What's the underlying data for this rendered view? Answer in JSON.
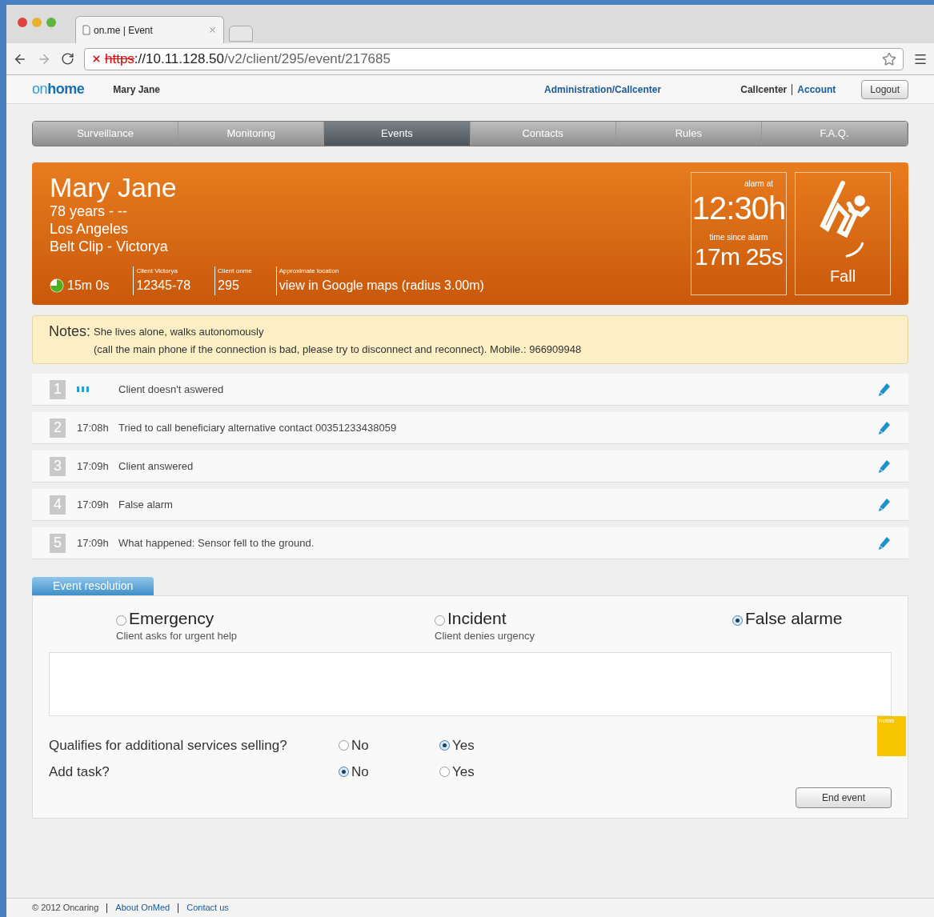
{
  "browser": {
    "tab_title": "on.me | Event",
    "url": {
      "scheme": "https",
      "host": "://10.11.128.50",
      "path": "/v2/client/295/event/217685"
    }
  },
  "header": {
    "logo": [
      "on",
      "home"
    ],
    "user": "Mary Jane",
    "admin_link": "Administration/Callcenter",
    "callcenter": "Callcenter",
    "account": "Account",
    "logout": "Logout"
  },
  "nav": [
    {
      "label": "Surveillance",
      "selected": false
    },
    {
      "label": "Monitoring",
      "selected": false
    },
    {
      "label": "Events",
      "selected": true
    },
    {
      "label": "Contacts",
      "selected": false
    },
    {
      "label": "Rules",
      "selected": false
    },
    {
      "label": "F.A.Q.",
      "selected": false
    }
  ],
  "client": {
    "name": "Mary Jane",
    "lines": [
      "78 years - --",
      "Los Angeles",
      "Belt Clip - Victorya"
    ],
    "timer": {
      "text": "15m 0s"
    },
    "fields": [
      {
        "label": "Client Victorya",
        "value": "12345-78"
      },
      {
        "label": "Client onme",
        "value": "295"
      },
      {
        "label": "Approximate location",
        "value": "view in Google maps (radius 3.00m)"
      }
    ],
    "alarm_label": "alarm at",
    "alarm_time": "12:30h",
    "since_label": "time since alarm",
    "since_value": "17m 25s",
    "event_type": "Fall"
  },
  "notes": {
    "label": "Notes:",
    "lines": [
      "She lives alone, walks autonomously",
      "(call the main phone if the connection is bad, please try to disconnect and reconnect). Mobile.: 966909948"
    ]
  },
  "events": [
    {
      "number": "1",
      "kind": "pending",
      "text": "Client doesn't aswered"
    },
    {
      "number": "2",
      "kind": "timed",
      "time": "17:08h",
      "text": "Tried to call beneficiary alternative contact 00351233438059"
    },
    {
      "number": "3",
      "kind": "timed",
      "time": "17:09h",
      "text": "Client answered"
    },
    {
      "number": "4",
      "kind": "timed",
      "time": "17:09h",
      "text": "False alarm"
    },
    {
      "number": "5",
      "kind": "timed",
      "time": "17:09h",
      "text": "What happened: Sensor fell to the ground."
    }
  ],
  "resolution": {
    "tab": "Event resolution",
    "options": [
      {
        "label": "Emergency",
        "hint": "Client asks for urgent help",
        "selected": false
      },
      {
        "label": "Incident",
        "hint": "Client denies urgency",
        "selected": false
      },
      {
        "label": "False alarme",
        "selected": true
      }
    ],
    "notes_tag": "notas",
    "questions": [
      {
        "label": "Qualifies for additional services selling?",
        "choices": [
          {
            "label": "No",
            "selected": false
          },
          {
            "label": "Yes",
            "selected": true
          }
        ]
      },
      {
        "label": "Add task?",
        "choices": [
          {
            "label": "No",
            "selected": true
          },
          {
            "label": "Yes",
            "selected": false
          }
        ]
      }
    ],
    "end_button": "End event"
  },
  "footer": [
    "© 2012 Oncaring",
    "About OnMed",
    "Contact us"
  ]
}
